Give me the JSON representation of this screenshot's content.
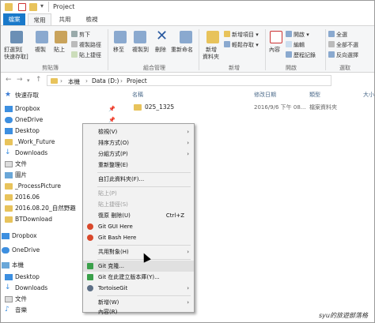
{
  "window": {
    "title": "Project"
  },
  "tabs": [
    {
      "label": "檔案"
    },
    {
      "label": "常用"
    },
    {
      "label": "共用"
    },
    {
      "label": "檢視"
    }
  ],
  "ribbon": {
    "pin_label": "釘選到[",
    "pin_label2": "快速存取]",
    "copy_label": "複製",
    "paste_label": "貼上",
    "cut_label": "剪下",
    "copy_path_label": "複製路徑",
    "paste_shortcut_label": "貼上捷徑",
    "clipboard_group": "剪貼簿",
    "move_label": "移至",
    "copy_to_label": "複製到",
    "delete_label": "刪除",
    "rename_label": "重新命名",
    "organize_group": "組合管理",
    "new_folder_label": "新增",
    "new_folder_label2": "資料夾",
    "new_item_label": "新增項目",
    "easy_access_label": "輕鬆存取",
    "new_group": "新增",
    "properties_label": "內容",
    "open_label": "開啟",
    "edit_label": "編輯",
    "history_label": "歷程記錄",
    "open_group": "開啟",
    "select_all_label": "全選",
    "select_none_label": "全部不選",
    "invert_label": "反向選擇",
    "select_group": "選取"
  },
  "address": {
    "crumbs": [
      "本機",
      "Data (D:)",
      "Project"
    ]
  },
  "nav": {
    "items": [
      {
        "label": "快速存取"
      },
      {
        "label": "Dropbox"
      },
      {
        "label": "OneDrive"
      },
      {
        "label": "Desktop"
      },
      {
        "label": "_Work_Future"
      },
      {
        "label": "Downloads"
      },
      {
        "label": "文件"
      },
      {
        "label": "圖片"
      },
      {
        "label": "_ProcessPicture"
      },
      {
        "label": "2016.06"
      },
      {
        "label": "2016.08.20_自然野趣"
      },
      {
        "label": "BTDownload"
      },
      {
        "label": "Dropbox"
      },
      {
        "label": "OneDrive"
      },
      {
        "label": "本機"
      },
      {
        "label": "Desktop"
      },
      {
        "label": "Downloads"
      },
      {
        "label": "文件"
      },
      {
        "label": "音樂"
      }
    ]
  },
  "filelist": {
    "col_name": "名稱",
    "col_modified": "修改日期",
    "col_type": "類型",
    "col_size": "大小",
    "rows": [
      {
        "name": "025_1325",
        "modified": "2016/9/6 下午 08...",
        "type": "檔案資料夾"
      }
    ]
  },
  "context_menu": {
    "items": [
      {
        "label": "檢視(V)"
      },
      {
        "label": "排序方式(O)"
      },
      {
        "label": "分組方式(P)"
      },
      {
        "label": "重新整理(E)"
      },
      {
        "label": "自訂此資料夾(F)..."
      },
      {
        "label": "貼上(P)"
      },
      {
        "label": "貼上捷徑(S)"
      },
      {
        "label": "復原 刪除(U)",
        "shortcut": "Ctrl+Z"
      },
      {
        "label": "Git GUI Here"
      },
      {
        "label": "Git Bash Here"
      },
      {
        "label": "共用對象(H)"
      },
      {
        "label": "Git 克隆..."
      },
      {
        "label": "Git 在此建立版本庫(Y)..."
      },
      {
        "label": "TortoiseGit"
      },
      {
        "label": "新增(W)"
      },
      {
        "label": "內容(R)"
      }
    ]
  },
  "watermark": "syu的旅遊部落格"
}
